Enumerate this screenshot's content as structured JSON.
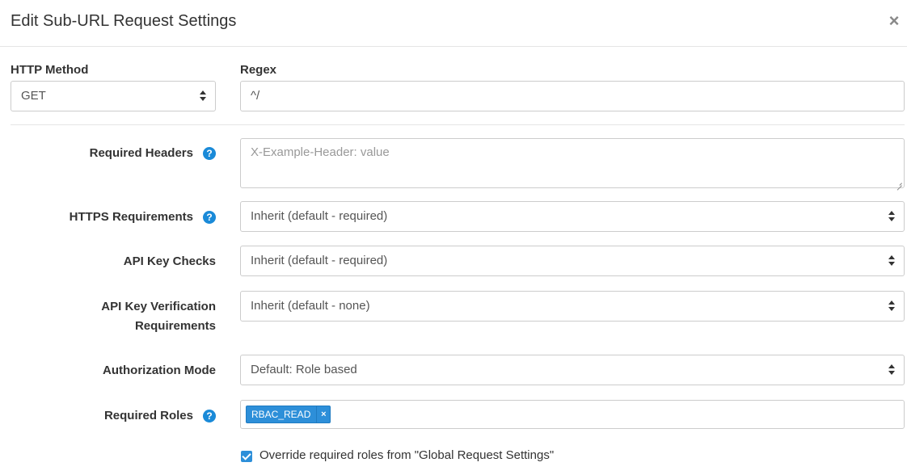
{
  "modal": {
    "title": "Edit Sub-URL Request Settings",
    "close_symbol": "×"
  },
  "http_method": {
    "label": "HTTP Method",
    "value": "GET"
  },
  "regex": {
    "label": "Regex",
    "value": "^/"
  },
  "required_headers": {
    "label": "Required Headers",
    "placeholder": "X-Example-Header: value",
    "help_icon": "question-circle-icon"
  },
  "https_requirements": {
    "label": "HTTPS Requirements",
    "value": "Inherit (default - required)",
    "help_icon": "question-circle-icon"
  },
  "api_key_checks": {
    "label": "API Key Checks",
    "value": "Inherit (default - required)"
  },
  "api_key_verification": {
    "label_line1": "API Key Verification",
    "label_line2": "Requirements",
    "value": "Inherit (default - none)"
  },
  "authorization_mode": {
    "label": "Authorization Mode",
    "value": "Default: Role based"
  },
  "required_roles": {
    "label": "Required Roles",
    "help_icon": "question-circle-icon",
    "tags": [
      "RBAC_READ"
    ],
    "tag_remove_symbol": "×"
  },
  "override_roles": {
    "checked": true,
    "label": "Override required roles from \"Global Request Settings\""
  },
  "colors": {
    "accent": "#2d8fd9",
    "help_icon": "#1a8ad8"
  }
}
